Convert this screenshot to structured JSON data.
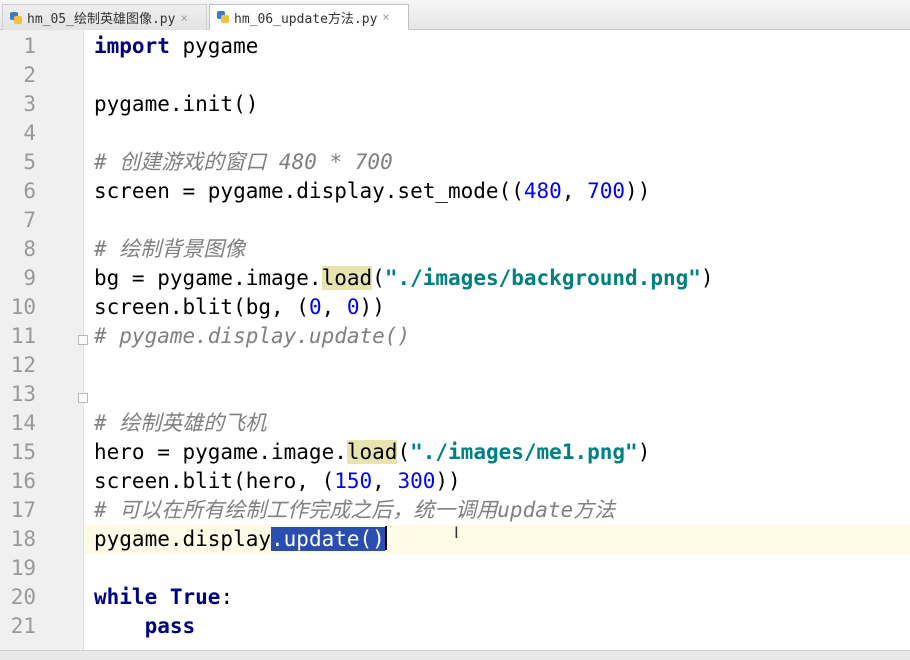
{
  "tabs": [
    {
      "label": "hm_05_绘制英雄图像.py",
      "close": "×",
      "active": false
    },
    {
      "label": "hm_06_update方法.py",
      "close": "×",
      "active": true
    }
  ],
  "line_numbers": [
    "1",
    "2",
    "3",
    "4",
    "5",
    "6",
    "7",
    "8",
    "9",
    "10",
    "11",
    "12",
    "13",
    "14",
    "15",
    "16",
    "17",
    "18",
    "19",
    "20",
    "21"
  ],
  "code": {
    "l1": {
      "kw": "import",
      "rest": " pygame"
    },
    "l3": {
      "text": "pygame.init()"
    },
    "l5": {
      "comment": "# 创建游戏的窗口 480 * 700"
    },
    "l6": {
      "a": "screen = pygame.display.set_mode((",
      "n1": "480",
      "b": ", ",
      "n2": "700",
      "c": "))"
    },
    "l8": {
      "comment": "# 绘制背景图像"
    },
    "l9": {
      "a": "bg = pygame.image.",
      "fn": "load",
      "b": "(",
      "str": "\"./images/background.png\"",
      "c": ")"
    },
    "l10": {
      "a": "screen.blit(bg, (",
      "n1": "0",
      "b": ", ",
      "n2": "0",
      "c": "))"
    },
    "l11": {
      "comment": "# pygame.display.update()"
    },
    "l13": {
      "comment": "# 绘制英雄的飞机"
    },
    "l14": {
      "a": "hero = pygame.image.",
      "fn": "load",
      "b": "(",
      "str": "\"./images/me1.png\"",
      "c": ")"
    },
    "l15": {
      "a": "screen.blit(hero, (",
      "n1": "150",
      "b": ", ",
      "n2": "300",
      "c": "))"
    },
    "l17": {
      "comment": "# 可以在所有绘制工作完成之后，统一调用update方法"
    },
    "l18": {
      "a": "pygame.display",
      "sel": ".update()"
    },
    "l20": {
      "kw1": "while",
      "sp": " ",
      "kw2": "True",
      "c": ":"
    },
    "l21": {
      "indent": "    ",
      "kw": "pass"
    }
  },
  "colors": {
    "keyword": "#000080",
    "number": "#0000ff",
    "string": "#008080",
    "comment": "#808080",
    "selection": "#2a4db0",
    "current_line": "#fdfbe6",
    "gutter": "#f0f0f0"
  },
  "icons": {
    "file": "python-file-icon",
    "close": "close-icon",
    "cursor": "text-cursor-icon"
  },
  "cursor_glyph": "I"
}
